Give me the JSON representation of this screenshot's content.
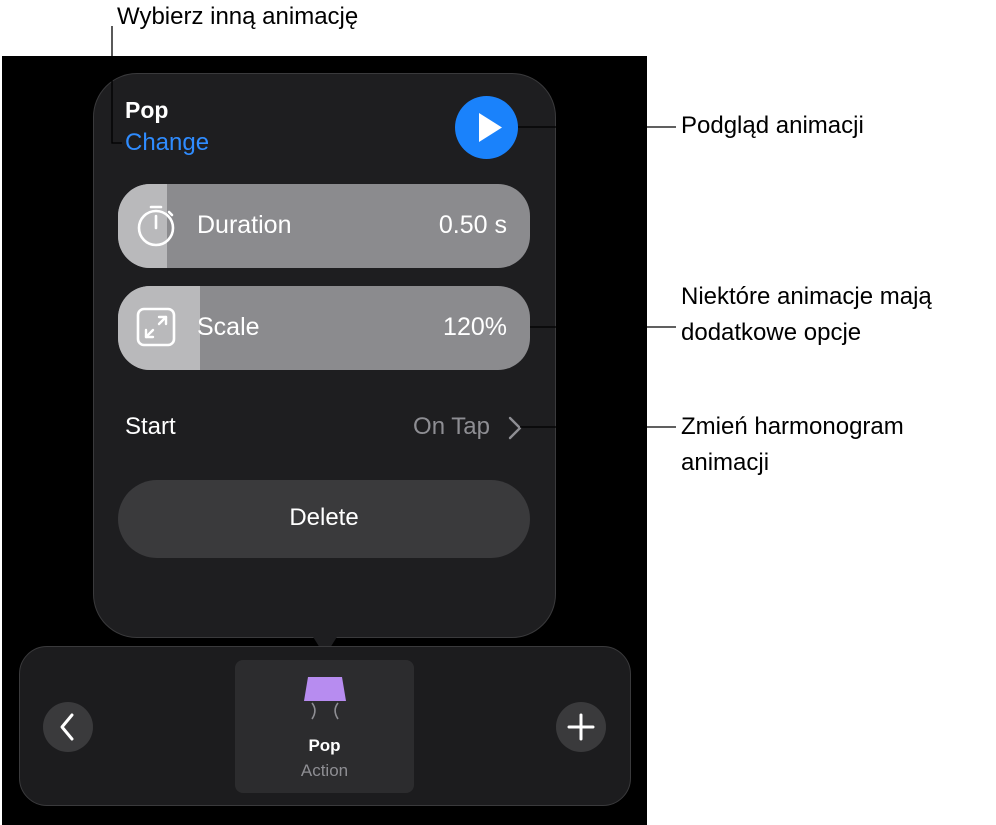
{
  "popover": {
    "animation_name": "Pop",
    "change_label": "Change",
    "sliders": [
      {
        "label": "Duration",
        "value": "0.50 s",
        "icon": "stopwatch-icon",
        "fill_fraction": 0.12
      },
      {
        "label": "Scale",
        "value": "120%",
        "icon": "expand-arrows-icon",
        "fill_fraction": 0.2
      }
    ],
    "start": {
      "label": "Start",
      "value": "On Tap"
    },
    "delete_label": "Delete"
  },
  "toolbar": {
    "card": {
      "title": "Pop",
      "subtitle": "Action",
      "icon": "pop-action-icon",
      "icon_color": "#b78cf0"
    }
  },
  "callouts": {
    "change": "Wybierz inną animację",
    "preview": "Podgląd animacji",
    "options": "Niektóre animacje mają dodatkowe opcje",
    "start": "Zmień harmonogram animacji"
  },
  "colors": {
    "accent": "#1a82fb",
    "link": "#2f8cff"
  }
}
